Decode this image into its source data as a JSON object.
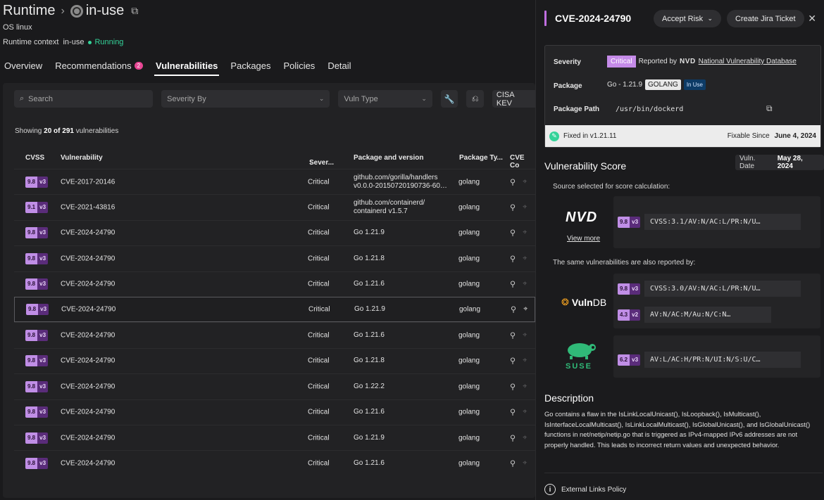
{
  "header": {
    "section": "Runtime",
    "runtime_name": "in-use",
    "os_label": "OS linux",
    "runtime_context_label": "Runtime context",
    "runtime_context_value": "in-use",
    "status": "Running"
  },
  "tabs": [
    {
      "label": "Overview"
    },
    {
      "label": "Recommendations",
      "badge": "2"
    },
    {
      "label": "Vulnerabilities",
      "active": true
    },
    {
      "label": "Packages"
    },
    {
      "label": "Policies"
    },
    {
      "label": "Detail"
    }
  ],
  "filters": {
    "search_placeholder": "Search",
    "severity_placeholder": "Severity By",
    "vuln_type_placeholder": "Vuln Type",
    "cisa_label": "CISA KEV"
  },
  "summary": {
    "prefix": "Showing",
    "shown": "20",
    "mid": "of",
    "total": "291",
    "suffix": "vulnerabilities"
  },
  "table": {
    "columns": [
      "CVSS",
      "Vulnerability",
      "Sever...",
      "Package and version",
      "Package Ty...",
      "CVE Co"
    ],
    "rows": [
      {
        "score": "9.8",
        "ver": "v3",
        "cve": "CVE-2017-20146",
        "severity": "Critical",
        "pkg": "github.com/gorilla/handlers",
        "pkg2": "v0.0.0-20150720190736-60…",
        "type": "golang"
      },
      {
        "score": "9.1",
        "ver": "v3",
        "cve": "CVE-2021-43816",
        "severity": "Critical",
        "pkg": "github.com/containerd/",
        "pkg2": "containerd v1.5.7",
        "type": "golang"
      },
      {
        "score": "9.8",
        "ver": "v3",
        "cve": "CVE-2024-24790",
        "severity": "Critical",
        "pkg": "Go 1.21.9",
        "pkg2": "",
        "type": "golang"
      },
      {
        "score": "9.8",
        "ver": "v3",
        "cve": "CVE-2024-24790",
        "severity": "Critical",
        "pkg": "Go 1.21.8",
        "pkg2": "",
        "type": "golang"
      },
      {
        "score": "9.8",
        "ver": "v3",
        "cve": "CVE-2024-24790",
        "severity": "Critical",
        "pkg": "Go 1.21.6",
        "pkg2": "",
        "type": "golang"
      },
      {
        "score": "9.8",
        "ver": "v3",
        "cve": "CVE-2024-24790",
        "severity": "Critical",
        "pkg": "Go 1.21.9",
        "pkg2": "",
        "type": "golang",
        "selected": true
      },
      {
        "score": "9.8",
        "ver": "v3",
        "cve": "CVE-2024-24790",
        "severity": "Critical",
        "pkg": "Go 1.21.6",
        "pkg2": "",
        "type": "golang"
      },
      {
        "score": "9.8",
        "ver": "v3",
        "cve": "CVE-2024-24790",
        "severity": "Critical",
        "pkg": "Go 1.21.8",
        "pkg2": "",
        "type": "golang"
      },
      {
        "score": "9.8",
        "ver": "v3",
        "cve": "CVE-2024-24790",
        "severity": "Critical",
        "pkg": "Go 1.22.2",
        "pkg2": "",
        "type": "golang"
      },
      {
        "score": "9.8",
        "ver": "v3",
        "cve": "CVE-2024-24790",
        "severity": "Critical",
        "pkg": "Go 1.21.6",
        "pkg2": "",
        "type": "golang"
      },
      {
        "score": "9.8",
        "ver": "v3",
        "cve": "CVE-2024-24790",
        "severity": "Critical",
        "pkg": "Go 1.21.9",
        "pkg2": "",
        "type": "golang"
      },
      {
        "score": "9.8",
        "ver": "v3",
        "cve": "CVE-2024-24790",
        "severity": "Critical",
        "pkg": "Go 1.21.6",
        "pkg2": "",
        "type": "golang"
      }
    ]
  },
  "drawer": {
    "title": "CVE-2024-24790",
    "accept_risk": "Accept Risk",
    "create_jira": "Create Jira Ticket",
    "severity_label": "Severity",
    "severity_value": "Critical",
    "reported_by": "Reported by",
    "nvd_mark": "NVD",
    "nvd_link": "National Vulnerability Database",
    "package_label": "Package",
    "package_value": "Go - 1.21.9",
    "package_type": "GOLANG",
    "in_use": "In Use",
    "path_label": "Package Path",
    "path_value": "/usr/bin/dockerd",
    "fixed_in": "Fixed in v1.21.11",
    "fixable_since_label": "Fixable Since",
    "fixable_since_value": "June 4, 2024",
    "vuln_date_label": "Vuln. Date",
    "vuln_date_value": "May 28, 2024",
    "score_title": "Vulnerability Score",
    "source_text": "Source selected for score calculation:",
    "view_more": "View more",
    "also_text": "The same vulnerabilities are also reported by:",
    "vulndb_a": "Vuln",
    "vulndb_b": "DB",
    "suse_text": "SUSE",
    "scores": {
      "nvd": {
        "score": "9.8",
        "ver": "v3",
        "vector": "CVSS:3.1/AV:N/AC:L/PR:N/U…"
      },
      "vulndb1": {
        "score": "9.8",
        "ver": "v3",
        "vector": "CVSS:3.0/AV:N/AC:L/PR:N/U…"
      },
      "vulndb2": {
        "score": "4.3",
        "ver": "v2",
        "vector": "AV:N/AC:M/Au:N/C:N…"
      },
      "suse": {
        "score": "6.2",
        "ver": "v3",
        "vector": "AV:L/AC:H/PR:N/UI:N/S:U/C…"
      }
    },
    "description_title": "Description",
    "description": "Go contains a flaw in the IsLinkLocalUnicast(), IsLoopback(), IsMulticast(), IsInterfaceLocalMulticast(), IsLinkLocalMulticast(), IsGlobalUnicast(), and IsGlobalUnicast() functions in net/netip/netip.go that is triggered as IPv4-mapped IPv6 addresses are not properly handled. This leads to incorrect return values and unexpected behavior.",
    "external_links": "External Links Policy"
  },
  "colors": {
    "accent": "#c58be8",
    "running": "#34d399",
    "badge": "#e74694",
    "in_use": "#0d3b66"
  }
}
